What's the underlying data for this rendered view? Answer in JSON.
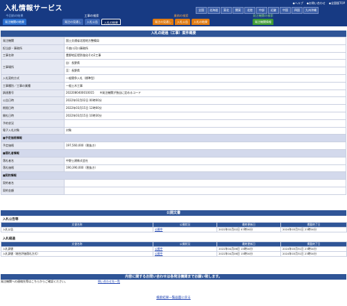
{
  "header": {
    "title": "入札情報サービス",
    "top_links": [
      "◆ヘルプ",
      "◆お問い合わせ",
      "◆全国版TOP"
    ],
    "regions": [
      "全国",
      "北海道",
      "東北",
      "関東",
      "北陸",
      "中部",
      "近畿",
      "中国",
      "四国",
      "九州沖縄"
    ]
  },
  "nav": [
    {
      "heading": "今回前の結果",
      "tabs": [
        "発注機関の結果"
      ],
      "color": "#2a6fd0"
    },
    {
      "heading": "工事の検索",
      "tabs": [
        "発注の見通し",
        "入札公告",
        "入札の結果"
      ],
      "color": "#1f4f9e"
    },
    {
      "heading": "業務の検索",
      "tabs": [
        "発注の見通し",
        "入札公告",
        "入札の結果"
      ],
      "color": "#e07b12"
    },
    {
      "heading": "発注機関の検索",
      "tabs": [
        "発注機関情報"
      ],
      "color": "#3f9c35"
    }
  ],
  "detail": {
    "section_title": "入札の経過（工事）案件概要",
    "rows": [
      {
        "k": "発注機関",
        "v": "国土交通省北陸地方整備局"
      },
      {
        "k": "担当部・事務所",
        "v": "千曲川河川事務所"
      },
      {
        "k": "工事名称",
        "v": "豊野地区堤防強化その2工事"
      },
      {
        "k": "工事場所",
        "v": "自：長野県",
        "v2": "至：長野県",
        "tall": true
      },
      {
        "k": "入札契約方式",
        "v": "一般競争入札（標準型）"
      },
      {
        "k": "工事種別／工事の業種",
        "v": "一般土木工事"
      },
      {
        "k": "調達番号",
        "v": "2022080400010015　　※発注機関が独自に定めるコード"
      },
      {
        "k": "公告日時",
        "v": "2022年02月02日 00時00分"
      },
      {
        "k": "期限日時",
        "v": "2022年03月15日 12時00分"
      },
      {
        "k": "開札日時",
        "v": "2022年03月15日 10時30分"
      },
      {
        "k": "予約状況",
        "v": ""
      },
      {
        "k": "電子入札対象",
        "v": "対象"
      }
    ],
    "estimate_header": "■予定価格情報",
    "estimate_rows": [
      {
        "k": "予定価格",
        "v": "197,560,000（税抜き）"
      }
    ],
    "winner_header": "■落札者情報",
    "winner_rows": [
      {
        "k": "落札者名",
        "v": "中野土建株式会社"
      },
      {
        "k": "落札価格",
        "v": "190,390,000（税抜き）"
      }
    ],
    "contract_header": "■契約情報",
    "contract_rows": [
      {
        "k": "契約者名",
        "v": ""
      },
      {
        "k": "契約金額",
        "v": ""
      }
    ]
  },
  "public_docs": {
    "section_title": "公開文書",
    "notice_title": "入札公告等",
    "columns": [
      "文書名称",
      "公開状況",
      "最終更新日",
      "掲載終了日"
    ],
    "notice_rows": [
      {
        "name": "入札公告",
        "status": "公開中",
        "updated": "2022年02月02日 07時00分",
        "end": "2024年03月31日 23時00分"
      }
    ],
    "result_title": "入札経過",
    "result_rows": [
      {
        "name": "入札調書",
        "status": "公開中",
        "updated": "2022年04月06日 15時00分",
        "end": "2024年03月31日 23時00分"
      },
      {
        "name": "入札調書（総合評価落札方式）",
        "status": "公開中",
        "updated": "2022年04月06日 15時00分",
        "end": "2024年03月31日 23時00分"
      }
    ]
  },
  "contact": {
    "section_title": "内容に関するお問い合わせは各発注機関までお願い致します。",
    "text": "発注機関への連絡先等はこちらからご確認ください。",
    "link": "問い合わせ先一覧"
  },
  "back_link": "検索結果一覧画面に戻る",
  "colors": {
    "header_bg": "#173a83",
    "section_bg": "#2f5597",
    "label_bg": "#e6e9f3"
  }
}
